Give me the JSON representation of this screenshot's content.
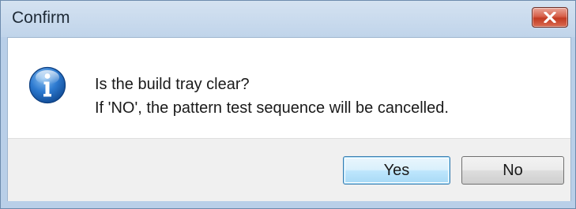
{
  "window": {
    "title": "Confirm",
    "close_icon": "close-x-icon"
  },
  "dialog": {
    "icon": "info-icon",
    "message_line1": "Is the build tray clear?",
    "message_line2": "If 'NO', the pattern test sequence will be cancelled."
  },
  "buttons": {
    "yes_label": "Yes",
    "no_label": "No",
    "default": "Yes"
  },
  "colors": {
    "close_button": "#c23b22",
    "info_icon": "#1b5fb4",
    "default_button_border": "#3c7fb1"
  }
}
